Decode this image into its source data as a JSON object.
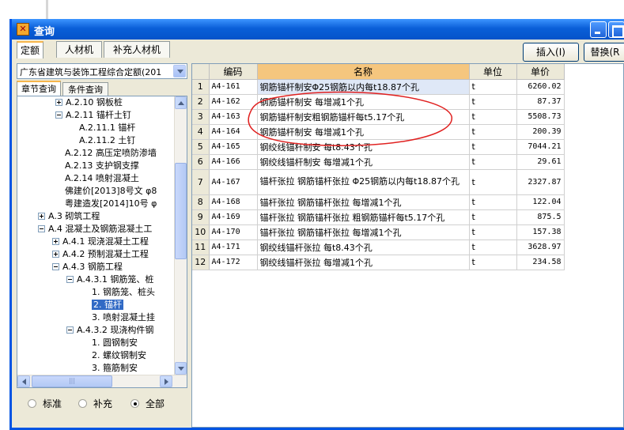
{
  "window": {
    "title": "查询"
  },
  "top_tabs": [
    "定额",
    "人材机",
    "补充人材机"
  ],
  "buttons": {
    "insert": "插入(I)",
    "replace": "替换(R"
  },
  "combo": {
    "value": "广东省建筑与装饰工程综合定额(201"
  },
  "left_tabs": [
    "章节查询",
    "条件查询"
  ],
  "tree": [
    {
      "label": "A.2.10 钢板桩",
      "exp": "plus"
    },
    {
      "label": "A.2.11 锚杆土钉",
      "exp": "minus"
    },
    {
      "label": "A.2.11.1 锚杆",
      "exp": ""
    },
    {
      "label": "A.2.11.2 土钉",
      "exp": ""
    },
    {
      "label": "A.2.12 高压定喷防渗墙",
      "exp": ""
    },
    {
      "label": "A.2.13 支护钢支撑",
      "exp": ""
    },
    {
      "label": "A.2.14 喷射混凝土",
      "exp": ""
    },
    {
      "label": "佛建价[2013]8号文 φ8",
      "exp": ""
    },
    {
      "label": "粤建造发[2014]10号 φ",
      "exp": ""
    },
    {
      "label": "A.3 砌筑工程",
      "exp": "plus"
    },
    {
      "label": "A.4 混凝土及钢筋混凝土工",
      "exp": "minus"
    },
    {
      "label": "A.4.1 现浇混凝土工程",
      "exp": "plus"
    },
    {
      "label": "A.4.2 预制混凝土工程",
      "exp": "plus"
    },
    {
      "label": "A.4.3 钢筋工程",
      "exp": "minus"
    },
    {
      "label": "A.4.3.1 钢筋笼、桩",
      "exp": "minus"
    },
    {
      "label": "1. 钢筋笼、桩头",
      "exp": ""
    },
    {
      "label": "2. 锚杆",
      "exp": "",
      "selected": true
    },
    {
      "label": "3. 喷射混凝土挂",
      "exp": ""
    },
    {
      "label": "A.4.3.2 现浇构件钢",
      "exp": "minus"
    },
    {
      "label": "1. 圆钢制安",
      "exp": ""
    },
    {
      "label": "2. 螺纹钢制安",
      "exp": ""
    },
    {
      "label": "3. 箍筋制安",
      "exp": ""
    }
  ],
  "radios": [
    {
      "label": "标准",
      "checked": false
    },
    {
      "label": "补充",
      "checked": false
    },
    {
      "label": "全部",
      "checked": true
    }
  ],
  "table": {
    "headers": [
      "",
      "编码",
      "名称",
      "单位",
      "单价"
    ],
    "rows": [
      {
        "n": "1",
        "code": "A4-161",
        "name": "钢筋锚杆制安Φ25钢筋以内每t18.87个孔",
        "unit": "t",
        "price": "6260.02"
      },
      {
        "n": "2",
        "code": "A4-162",
        "name": "钢筋锚杆制安 每增减1个孔",
        "unit": "t",
        "price": "87.37"
      },
      {
        "n": "3",
        "code": "A4-163",
        "name": "钢筋锚杆制安粗钢筋锚杆每t5.17个孔",
        "unit": "t",
        "price": "5508.73"
      },
      {
        "n": "4",
        "code": "A4-164",
        "name": "钢筋锚杆制安 每增减1个孔",
        "unit": "t",
        "price": "200.39"
      },
      {
        "n": "5",
        "code": "A4-165",
        "name": "钢绞线锚杆制安 每t8.43个孔",
        "unit": "t",
        "price": "7044.21"
      },
      {
        "n": "6",
        "code": "A4-166",
        "name": "钢绞线锚杆制安 每增减1个孔",
        "unit": "t",
        "price": "29.61"
      },
      {
        "n": "7",
        "code": "A4-167",
        "name": "锚杆张拉 钢筋锚杆张拉 Φ25钢筋以内每t18.87个孔",
        "unit": "t",
        "price": "2327.87"
      },
      {
        "n": "8",
        "code": "A4-168",
        "name": "锚杆张拉 钢筋锚杆张拉 每增减1个孔",
        "unit": "t",
        "price": "122.04"
      },
      {
        "n": "9",
        "code": "A4-169",
        "name": "锚杆张拉 钢筋锚杆张拉 粗钢筋锚杆每t5.17个孔",
        "unit": "t",
        "price": "875.5"
      },
      {
        "n": "10",
        "code": "A4-170",
        "name": "锚杆张拉 钢筋锚杆张拉 每增减1个孔",
        "unit": "t",
        "price": "157.38"
      },
      {
        "n": "11",
        "code": "A4-171",
        "name": "钢绞线锚杆张拉 每t8.43个孔",
        "unit": "t",
        "price": "3628.97"
      },
      {
        "n": "12",
        "code": "A4-172",
        "name": "钢绞线锚杆张拉 每增减1个孔",
        "unit": "t",
        "price": "234.58"
      }
    ]
  },
  "colors": {
    "titlebar": "#0a5fd8",
    "header_highlight": "#f5c67e",
    "selection": "#316ac5",
    "annotation": "#e0201f"
  }
}
